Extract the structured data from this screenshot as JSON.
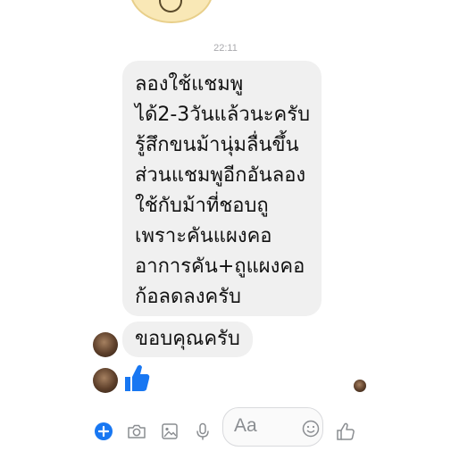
{
  "chat": {
    "timestamp": "22:11",
    "incoming_message": {
      "lines": [
        "ลองใช้แชมพู",
        "ได้2-3วันแล้วนะครับ",
        "รู้สึกขนม้านุ่มลื่นขึ้น",
        "ส่วนแชมพูอีกอันลอง",
        "ใช้กับม้าที่ชอบถู",
        "เพราะคันแผงคอ",
        "อาการคัน+ถูแผงคอ",
        "ก้อลดลงครับ"
      ]
    },
    "reply_message": "ขอบคุณครับ",
    "like_sticker_icon": "thumbs-up-icon"
  },
  "composer": {
    "placeholder": "Aa",
    "icons": [
      "plus-icon",
      "camera-icon",
      "photo-icon",
      "mic-icon",
      "emoji-icon",
      "thumbs-up-icon"
    ],
    "accent_color": "#1877f2",
    "icon_color": "#8a8d91"
  }
}
